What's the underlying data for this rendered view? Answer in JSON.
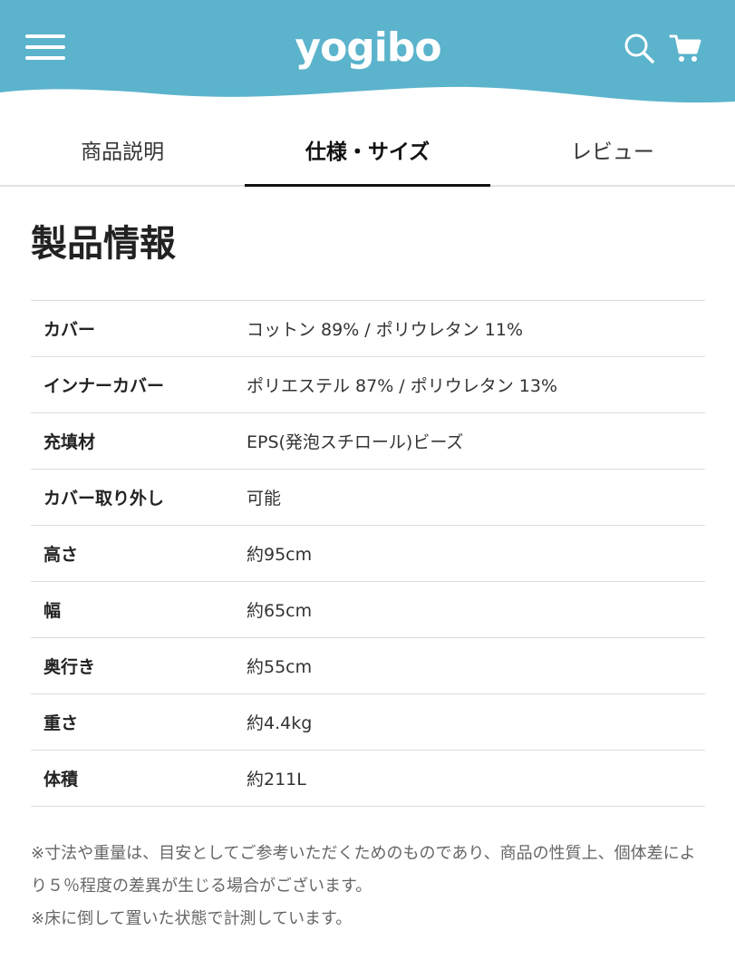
{
  "header": {
    "logo_text": "yogibo",
    "brand_color": "#5bb3cc",
    "menu_icon": "hamburger-icon",
    "search_icon": "search-icon",
    "cart_icon": "cart-icon"
  },
  "tabs": [
    {
      "label": "商品説明",
      "active": false
    },
    {
      "label": "仕様・サイズ",
      "active": true
    },
    {
      "label": "レビュー",
      "active": false
    }
  ],
  "section": {
    "title": "製品情報"
  },
  "specs": [
    {
      "label": "カバー",
      "value": "コットン 89% / ポリウレタン 11%"
    },
    {
      "label": "インナーカバー",
      "value": "ポリエステル 87% / ポリウレタン 13%"
    },
    {
      "label": "充填材",
      "value": "EPS(発泡スチロール)ビーズ"
    },
    {
      "label": "カバー取り外し",
      "value": "可能"
    },
    {
      "label": "高さ",
      "value": "約95cm"
    },
    {
      "label": "幅",
      "value": "約65cm"
    },
    {
      "label": "奥行き",
      "value": "約55cm"
    },
    {
      "label": "重さ",
      "value": "約4.4kg"
    },
    {
      "label": "体積",
      "value": "約211L"
    }
  ],
  "notes": [
    "※寸法や重量は、目安としてご参考いただくためのものであり、商品の性質上、個体差により５％程度の差異が生じる場合がございます。",
    "※床に倒して置いた状態で計測しています。"
  ]
}
